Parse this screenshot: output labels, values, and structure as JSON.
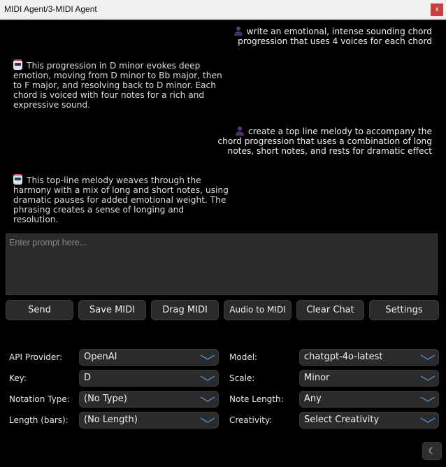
{
  "window": {
    "title": "MIDI Agent/3-MIDI Agent",
    "close_label": "x"
  },
  "chat": {
    "messages": [
      {
        "role": "user",
        "icon": "user-avatar-icon",
        "line1": "write an emotional, intense sounding chord",
        "line2": "progression that uses 4 voices for each chord"
      },
      {
        "role": "assistant",
        "icon": "robot-avatar-icon",
        "lines": [
          "This progression in D minor evokes deep",
          "emotion, moving from D minor to Bb major, then",
          "to F major, and resolving back to D minor. Each",
          "chord is voiced with four notes for a rich and",
          "expressive sound."
        ]
      },
      {
        "role": "user",
        "icon": "user-avatar-icon",
        "lines": [
          "create a top line melody to accompany the",
          "chord progression that uses a combination of long",
          "notes, short notes, and rests for dramatic effect"
        ]
      },
      {
        "role": "assistant",
        "icon": "robot-avatar-icon",
        "lines": [
          "This top-line melody weaves through the",
          "harmony with a mix of long and short notes, using",
          "dramatic pauses for added emotional weight. The",
          "phrasing creates a sense of longing and",
          "resolution."
        ]
      }
    ]
  },
  "prompt": {
    "placeholder": "Enter prompt here...",
    "value": ""
  },
  "buttons": {
    "send": "Send",
    "save_midi": "Save MIDI",
    "drag_midi": "Drag MIDI",
    "audio_to_midi": "Audio to MIDI",
    "clear_chat": "Clear Chat",
    "settings": "Settings"
  },
  "settings": {
    "api_provider": {
      "label": "API Provider:",
      "value": "OpenAI"
    },
    "model": {
      "label": "Model:",
      "value": "chatgpt-4o-latest"
    },
    "key": {
      "label": "Key:",
      "value": "D"
    },
    "scale": {
      "label": "Scale:",
      "value": "Minor"
    },
    "notation_type": {
      "label": "Notation Type:",
      "value": "(No Type)"
    },
    "note_length": {
      "label": "Note Length:",
      "value": "Any"
    },
    "length_bars": {
      "label": "Length (bars):",
      "value": "(No Length)"
    },
    "creativity": {
      "label": "Creativity:",
      "value": "Select Creativity"
    }
  },
  "theme_toggle": {
    "icon": "moon-icon",
    "glyph": "☾"
  },
  "colors": {
    "background": "#000000",
    "panel": "#2b2b2d",
    "chevron": "#4a86b8",
    "close": "#c94040"
  }
}
